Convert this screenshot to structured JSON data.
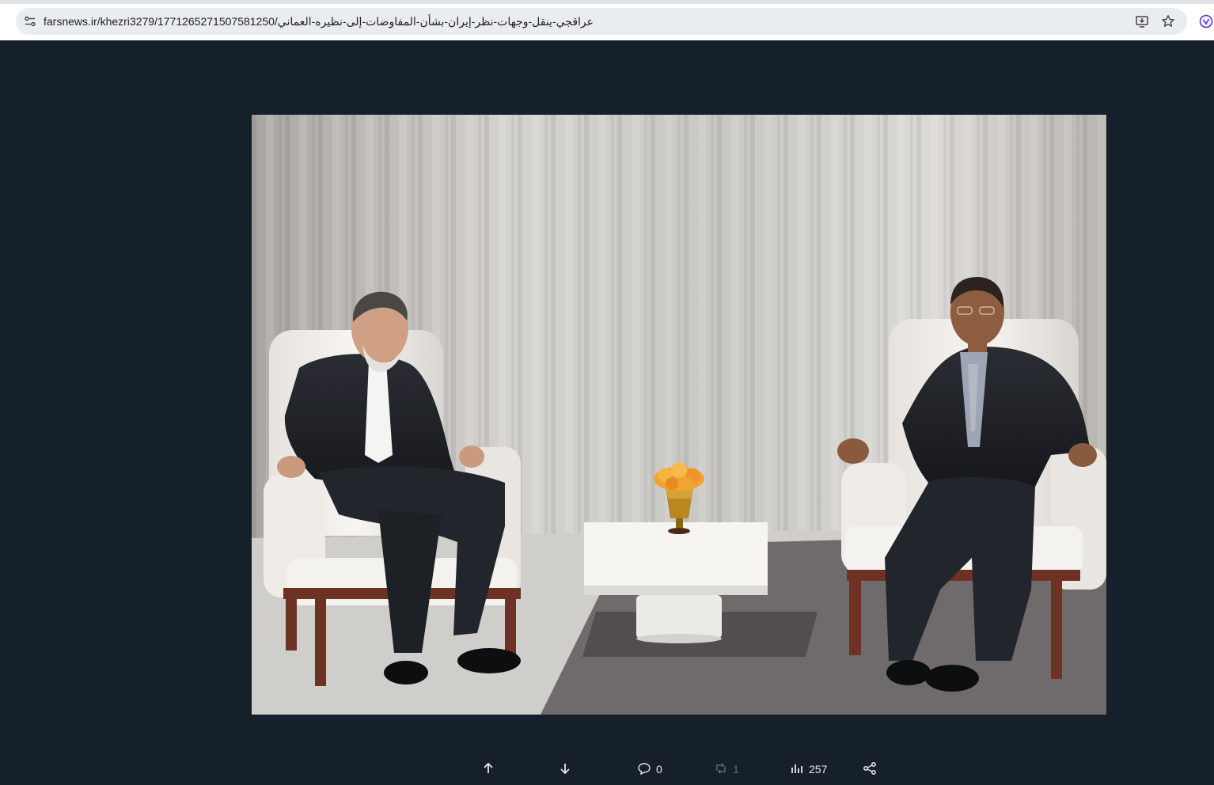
{
  "browser": {
    "url_host": "farsnews.ir",
    "url_path": "/khezri3279/1771265271507581250/عراقجي-ينقل-وجهات-نظر-إيران-بشأن-المفاوضات-إلى-نظيره-العماني",
    "icons": [
      "site-settings-icon",
      "install-app-icon",
      "bookmark-star-icon",
      "extension-icon"
    ]
  },
  "media": {
    "image_semantic": "photo-two-men-seated-armchairs",
    "accent_bg": "#16202a"
  },
  "actions": {
    "prev_icon": "arrow-up-icon",
    "next_icon": "arrow-down-icon",
    "replies_count": "0",
    "reposts_count": "1",
    "views_count": "257",
    "share_icon": "share-icon"
  }
}
